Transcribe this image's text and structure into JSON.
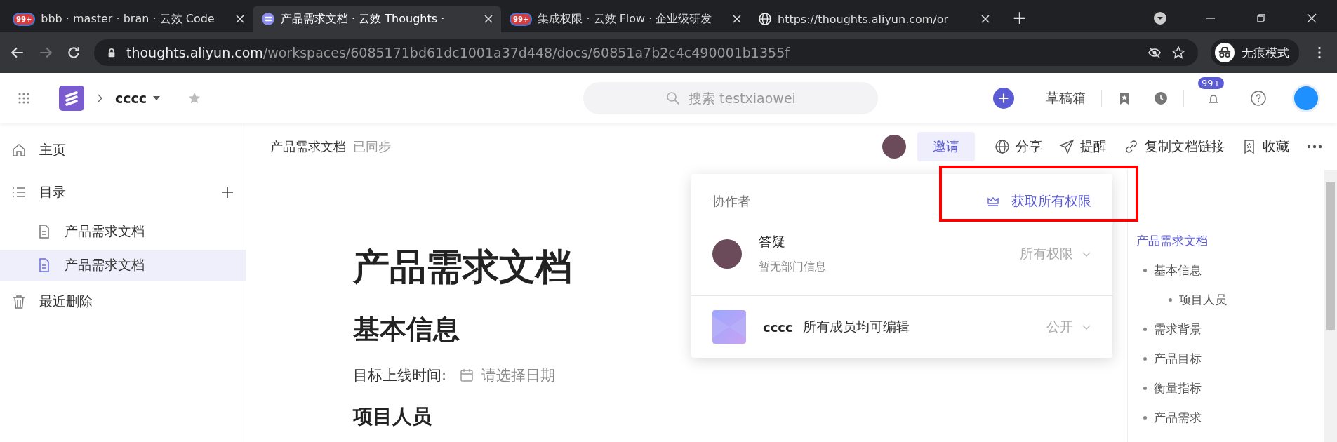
{
  "browser": {
    "tabs": [
      {
        "title": "bbb · master · bran · 云效 Code",
        "badge": "99+",
        "kind": "badge",
        "selected": false
      },
      {
        "title": "产品需求文档 · 云效 Thoughts ·",
        "kind": "app",
        "selected": true
      },
      {
        "title": "集成权限 · 云效 Flow · 企业级研发",
        "badge": "99+",
        "kind": "badge",
        "selected": false
      },
      {
        "title": "https://thoughts.aliyun.com/or",
        "kind": "globe",
        "selected": false
      }
    ],
    "new_tab": "+",
    "url_host": "thoughts.aliyun.com",
    "url_path": "/workspaces/6085171bd61dc1001a37d448/docs/60851a7b2c4c490001b1355f",
    "incognito": "无痕模式"
  },
  "header": {
    "workspace": "cccc",
    "search": {
      "placeholder": "搜索 testxiaowei"
    },
    "drafts": "草稿箱",
    "notifications": "99+"
  },
  "sidebar": {
    "items": [
      {
        "kind": "home",
        "label": "主页",
        "selected": false
      },
      {
        "kind": "toc",
        "label": "目录",
        "selected": false,
        "children": [
          {
            "kind": "doc",
            "label": "产品需求文档",
            "selected": false
          },
          {
            "kind": "doc",
            "label": "产品需求文档",
            "selected": true
          }
        ]
      },
      {
        "kind": "trash",
        "label": "最近删除",
        "selected": false
      }
    ]
  },
  "doc": {
    "breadcrumb": "产品需求文档",
    "sync": "已同步",
    "invite": "邀请",
    "actions": [
      {
        "kind": "globe",
        "label": "分享"
      },
      {
        "kind": "send",
        "label": "提醒"
      },
      {
        "kind": "link",
        "label": "复制文档链接"
      },
      {
        "kind": "bookmark",
        "label": "收藏"
      }
    ],
    "title": "产品需求文档",
    "h2": "基本信息",
    "date_label": "目标上线时间:",
    "date_placeholder": "请选择日期",
    "h3": "项目人员"
  },
  "popup": {
    "title": "协作者",
    "get_permission": "获取所有权限",
    "members": [
      {
        "kind": "user",
        "name": "答疑",
        "sub": "暂无部门信息",
        "role": "所有权限"
      },
      {
        "kind": "team",
        "name": "cccc",
        "desc": "所有成员均可编辑",
        "role": "公开"
      }
    ]
  },
  "outline": {
    "items": [
      {
        "label": "产品需求文档",
        "selected": true
      },
      {
        "label": "基本信息",
        "selected": false,
        "children": [
          {
            "label": "项目人员",
            "selected": false
          }
        ]
      },
      {
        "label": "需求背景",
        "selected": false
      },
      {
        "label": "产品目标",
        "selected": false
      },
      {
        "label": "衡量指标",
        "selected": false
      },
      {
        "label": "产品需求",
        "selected": false
      }
    ]
  }
}
